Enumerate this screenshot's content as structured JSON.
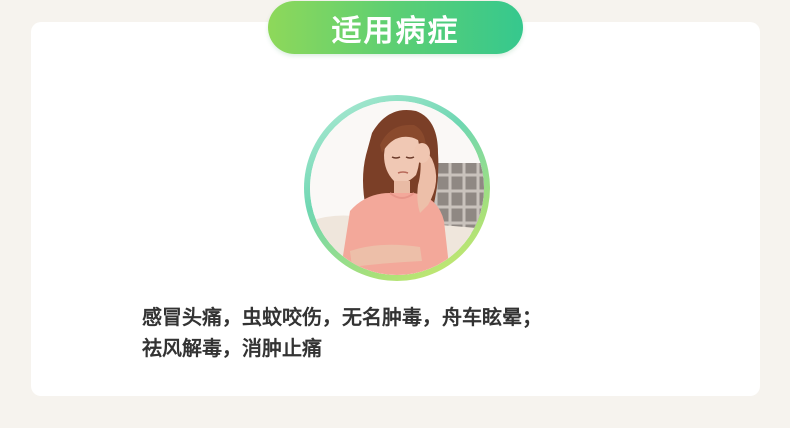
{
  "header": {
    "title": "适用病症"
  },
  "illustration": {
    "icon": "woman-headache-photo"
  },
  "description": {
    "line1": "感冒头痛，虫蚊咬伤，无名肿毒，舟车眩晕；",
    "line2": "祛风解毒，消肿止痛"
  },
  "colors": {
    "accent_start": "#8ed85a",
    "accent_end": "#36c88e",
    "text": "#333333",
    "background": "#f6f3ee"
  }
}
